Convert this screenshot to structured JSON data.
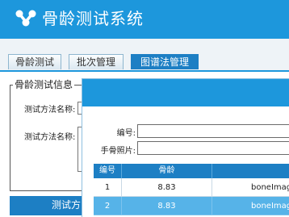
{
  "app": {
    "title": "骨龄测试系统"
  },
  "tabs": [
    {
      "label": "骨龄测试",
      "active": false
    },
    {
      "label": "批次管理",
      "active": false
    },
    {
      "label": "图谱法管理",
      "active": true
    }
  ],
  "background_form": {
    "legend": "骨龄测试信息",
    "method_name_label_1": "测试方法名称:",
    "method_name_label_2": "测试方法名称:",
    "footer_bar_text": "测试方"
  },
  "dialog": {
    "fields": {
      "number_label": "编号:",
      "number_value": "",
      "hand_photo_label": "手骨照片:",
      "hand_photo_value": ""
    },
    "table": {
      "headers": [
        "编号",
        "骨龄",
        ""
      ],
      "rows": [
        {
          "id": "1",
          "bone_age": "8.83",
          "image": "boneImage",
          "selected": false
        },
        {
          "id": "2",
          "bone_age": "8.83",
          "image": "boneImage",
          "selected": true
        }
      ]
    }
  },
  "colors": {
    "brand": "#1d97dc",
    "active_tab": "#1d7fc4",
    "selected_row": "#56b3e8"
  }
}
